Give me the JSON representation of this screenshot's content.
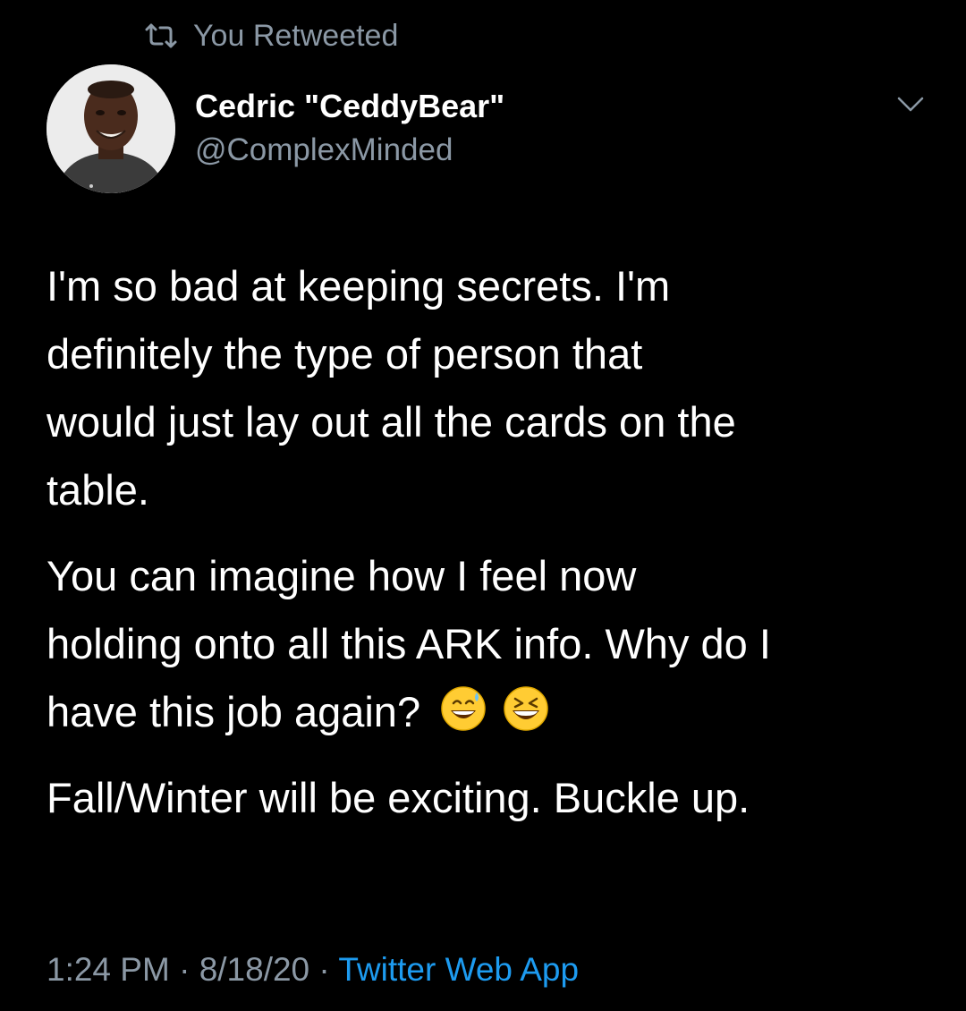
{
  "retweet": {
    "icon": "retweet-icon",
    "label": "You Retweeted"
  },
  "author": {
    "avatar": "avatar-photo",
    "display_name": "Cedric \"CeddyBear\"",
    "handle": "@ComplexMinded"
  },
  "menu": {
    "icon": "chevron-down-icon"
  },
  "tweet": {
    "paragraph1": "I'm so bad at keeping secrets.  I'm\ndefinitely the type of person that\nwould just lay out all the cards on the\ntable.",
    "paragraph2": "You can imagine how I feel now\nholding onto all this ARK info.  Why do I\nhave this job again?",
    "emojis": [
      "grinning-face-with-sweat-emoji",
      "grinning-squinting-face-emoji"
    ],
    "paragraph3": "Fall/Winter will be exciting. Buckle up."
  },
  "meta": {
    "time": "1:24 PM",
    "separator": " · ",
    "date": "8/18/20",
    "source": "Twitter Web App"
  },
  "colors": {
    "background": "#000000",
    "text": "#ffffff",
    "secondary": "#8b98a5",
    "link": "#1d9bf0"
  }
}
